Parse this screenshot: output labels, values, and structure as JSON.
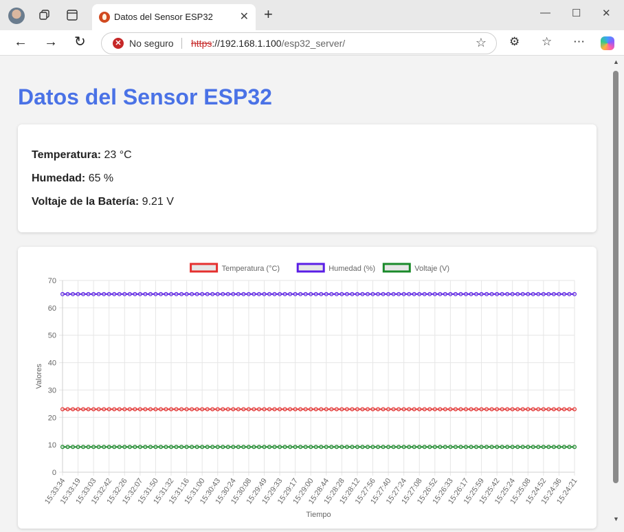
{
  "browser": {
    "tab_title": "Datos del Sensor ESP32",
    "security_text": "No seguro",
    "url_scheme": "https",
    "url_host": "://192.168.1.100",
    "url_path": "/esp32_server/"
  },
  "page": {
    "title": "Datos del Sensor ESP32",
    "readings": [
      {
        "label": "Temperatura:",
        "value": "23 °C"
      },
      {
        "label": "Humedad:",
        "value": "65 %"
      },
      {
        "label": "Voltaje de la Batería:",
        "value": "9.21 V"
      }
    ]
  },
  "colors": {
    "temperature": "#e5302f",
    "humidity": "#5a1ee6",
    "voltage": "#1a8a2a",
    "title": "#4a72e6"
  },
  "chart_data": {
    "type": "line",
    "xlabel": "Tiempo",
    "ylabel": "Valores",
    "ylim": [
      0,
      70
    ],
    "yticks": [
      0,
      10,
      20,
      30,
      40,
      50,
      60,
      70
    ],
    "grid": true,
    "legend_position": "top",
    "x_tick_labels": [
      "15:33:34",
      "15:33:19",
      "15:33:03",
      "15:32:42",
      "15:32:26",
      "15:32:07",
      "15:31:50",
      "15:31:32",
      "15:31:16",
      "15:31:00",
      "15:30:43",
      "15:30:24",
      "15:30:08",
      "15:29:49",
      "15:29:33",
      "15:29:17",
      "15:29:00",
      "15:28:44",
      "15:28:28",
      "15:28:12",
      "15:27:56",
      "15:27:40",
      "15:27:24",
      "15:27:08",
      "15:26:52",
      "15:26:33",
      "15:26:17",
      "15:25:59",
      "15:25:42",
      "15:25:24",
      "15:25:08",
      "15:24:52",
      "15:24:36",
      "15:24:21"
    ],
    "point_count": 100,
    "series": [
      {
        "name": "Temperatura (°C)",
        "value": 23,
        "color": "#e5302f"
      },
      {
        "name": "Humedad (%)",
        "value": 65,
        "color": "#5a1ee6"
      },
      {
        "name": "Voltaje (V)",
        "value": 9.21,
        "color": "#1a8a2a"
      }
    ]
  }
}
